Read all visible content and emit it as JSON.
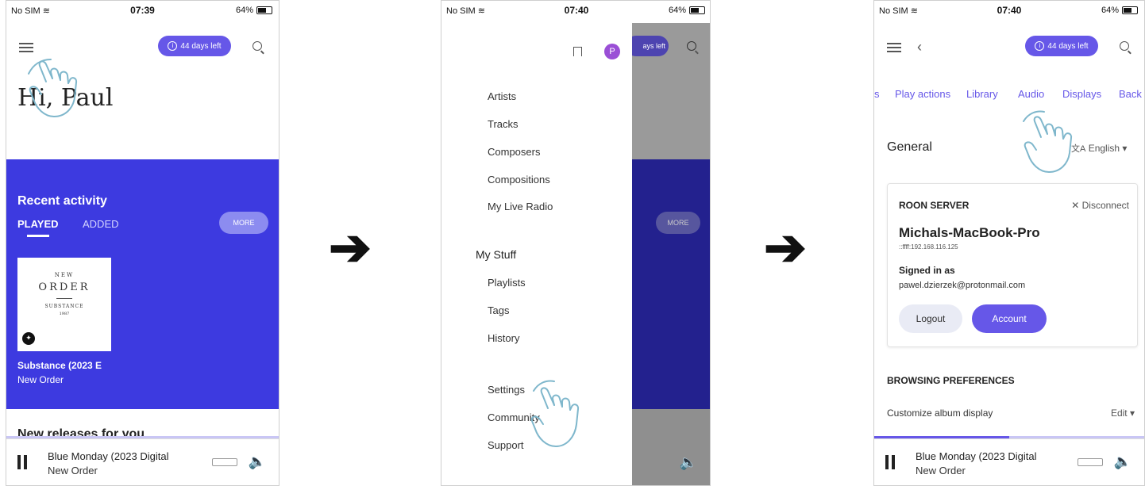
{
  "screens": [
    {
      "status": {
        "carrier": "No SIM",
        "time": "07:39",
        "battery": "64%"
      },
      "trial_pill": "44 days left",
      "greeting": "Hi, Paul",
      "recent": {
        "title": "Recent activity",
        "tab_played": "PLAYED",
        "tab_added": "ADDED",
        "more": "MORE"
      },
      "album": {
        "line1": "NEW",
        "line2": "ORDER",
        "line3": "SUBSTANCE",
        "line4": "1987",
        "title": "Substance (2023 E",
        "artist": "New Order"
      },
      "new_releases": "New releases for you",
      "player": {
        "title": "Blue Monday (2023 Digital",
        "artist": "New Order"
      }
    },
    {
      "status": {
        "carrier": "No SIM",
        "time": "07:40",
        "battery": "64%"
      },
      "avatar": "P",
      "menu_items": [
        "Artists",
        "Tracks",
        "Composers",
        "Compositions",
        "My Live Radio"
      ],
      "my_stuff": "My Stuff",
      "stuff_items": [
        "Playlists",
        "Tags",
        "History"
      ],
      "bottom_items": [
        "Settings",
        "Community",
        "Support"
      ],
      "bg_pill": "ays left",
      "bg_more": "MORE"
    },
    {
      "status": {
        "carrier": "No SIM",
        "time": "07:40",
        "battery": "64%"
      },
      "trial_pill": "44 days left",
      "tabs": [
        "s",
        "Play actions",
        "Library",
        "Audio",
        "Displays",
        "Back"
      ],
      "general": "General",
      "language": "English",
      "server": {
        "label": "ROON SERVER",
        "disconnect": "Disconnect",
        "name": "Michals-MacBook-Pro",
        "address": "::ffff:192.168.116.125",
        "signed_in_label": "Signed in as",
        "email": "pawel.dzierzek@protonmail.com",
        "logout": "Logout",
        "account": "Account"
      },
      "browsing": "BROWSING PREFERENCES",
      "customize": "Customize album display",
      "edit": "Edit",
      "player": {
        "title": "Blue Monday (2023 Digital",
        "artist": "New Order"
      }
    }
  ],
  "colors": {
    "accent": "#6657e8",
    "recent_bg": "#3d3ae0",
    "pill": "#6657e8"
  }
}
